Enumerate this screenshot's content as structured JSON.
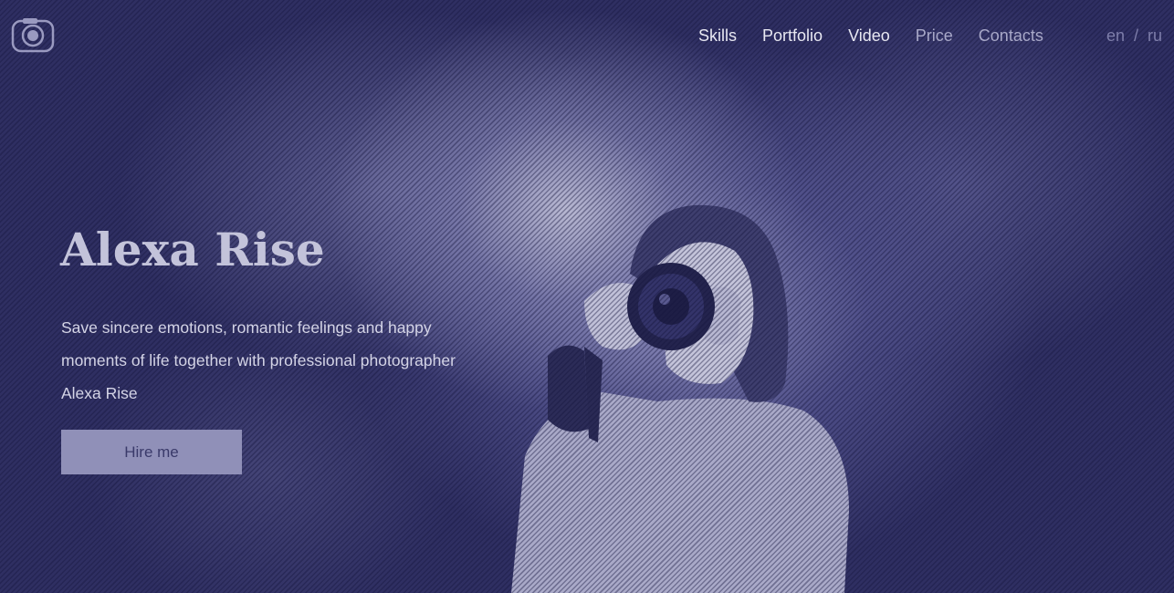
{
  "header": {
    "logo_icon": "camera-icon",
    "nav": [
      {
        "label": "Skills"
      },
      {
        "label": "Portfolio"
      },
      {
        "label": "Video"
      },
      {
        "label": "Price"
      },
      {
        "label": "Contacts"
      }
    ],
    "lang": {
      "en": "en",
      "separator": "/",
      "ru": "ru"
    }
  },
  "hero": {
    "title": "Alexa Rise",
    "description": "Save sincere emotions, romantic feelings and happy moments of life together with professional photographer Alexa Rise",
    "cta_label": "Hire me"
  },
  "colors": {
    "background": "#2f2f62",
    "accent": "#9090b8",
    "text": "#e8e8f2"
  }
}
